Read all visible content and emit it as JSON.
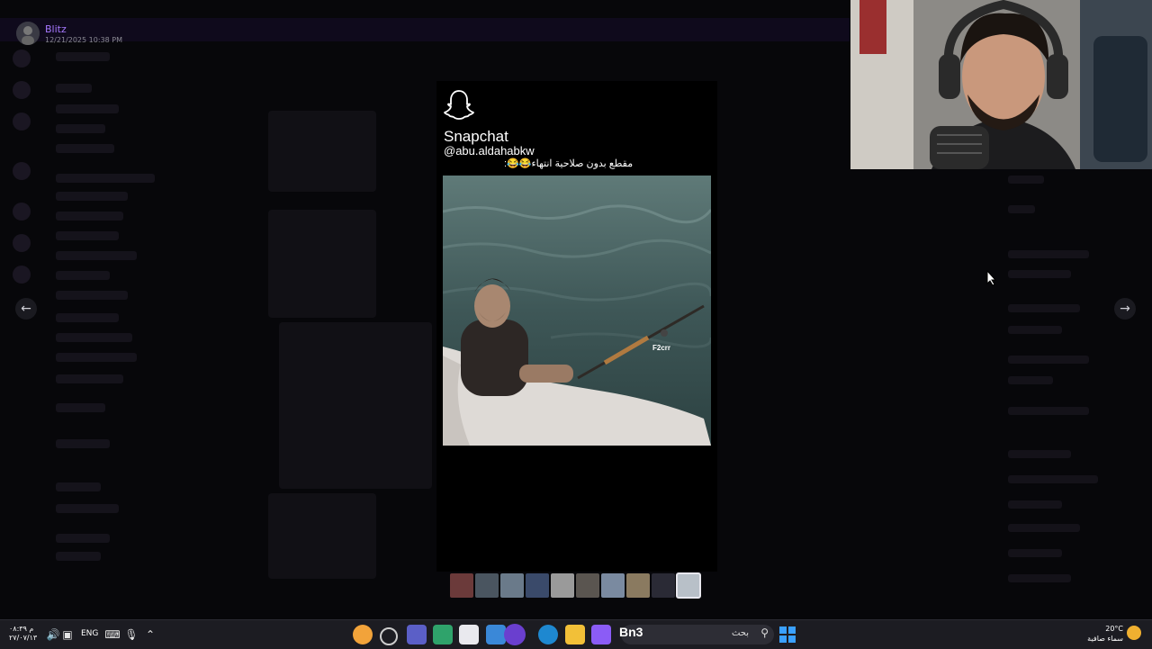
{
  "message": {
    "author": "Blitz",
    "timestamp": "12/21/2025 10:38 PM"
  },
  "media": {
    "brand": "Snapchat",
    "handle": "@abu.aldahabkw",
    "caption": "مقطع بدون صلاحية انتهاء😂😂:",
    "watermark": "F2crr"
  },
  "nav": {
    "prev_icon": "arrow-left-icon",
    "next_icon": "arrow-right-icon"
  },
  "filmstrip": {
    "count": 10,
    "selected_index": 9,
    "thumb_colors": [
      "#6b3a3a",
      "#4a5560",
      "#6a7a8a",
      "#3a4a6a",
      "#9a9a9a",
      "#5a5550",
      "#7a8aa0",
      "#8a7a60",
      "#2a2a35",
      "#b8c0c8"
    ]
  },
  "taskbar": {
    "clock_time": "م ٠٨:٣٩",
    "clock_date": "٢٧/٠٧/١٣",
    "language": "ENG",
    "search_label": "بحث",
    "pinned_text": "Bn3",
    "weather_temp": "20°C",
    "weather_desc": "سماء صافية"
  },
  "colors": {
    "accent": "#a678ff",
    "taskbar": "#1c1c22"
  }
}
